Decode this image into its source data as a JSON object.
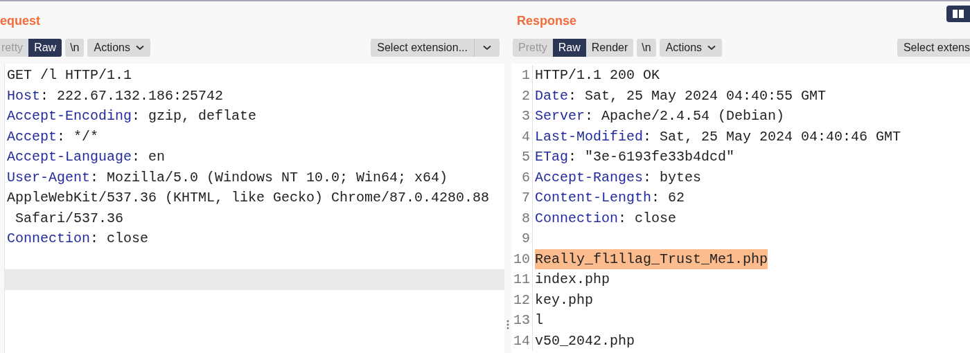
{
  "request": {
    "title": "equest",
    "view_tabs": [
      {
        "label": "retty",
        "selected": false
      },
      {
        "label": "Raw",
        "selected": true
      }
    ],
    "newline_button": "\\n",
    "actions_button": "Actions",
    "extension_select": "Select extension...",
    "lines": [
      {
        "value": "GET /l HTTP/1.1"
      },
      {
        "key": "Host",
        "value": ": 222.67.132.186:25742"
      },
      {
        "key": "Accept-Encoding",
        "value": ": gzip, deflate"
      },
      {
        "key": "Accept",
        "value": ": */*"
      },
      {
        "key": "Accept-Language",
        "value": ": en"
      },
      {
        "key": "User-Agent",
        "value": ": Mozilla/5.0 (Windows NT 10.0; Win64; x64)"
      },
      {
        "value": "AppleWebKit/537.36 (KHTML, like Gecko) Chrome/87.0.4280.88"
      },
      {
        "value": " Safari/537.36"
      },
      {
        "key": "Connection",
        "value": ": close"
      }
    ],
    "current_line": {
      "highlighted": true
    }
  },
  "response": {
    "title": "Response",
    "view_tabs": [
      {
        "label": "Pretty",
        "selected": false
      },
      {
        "label": "Raw",
        "selected": true
      },
      {
        "label": "Render",
        "selected": false
      }
    ],
    "newline_button": "\\n",
    "actions_button": "Actions",
    "extension_select": "Select extens",
    "lines": [
      {
        "number": "1",
        "value": "HTTP/1.1 200 OK",
        "highlighted": false
      },
      {
        "number": "2",
        "key": "Date",
        "value": ": Sat, 25 May 2024 04:40:55 GMT",
        "highlighted": false
      },
      {
        "number": "3",
        "key": "Server",
        "value": ": Apache/2.4.54 (Debian)",
        "highlighted": false
      },
      {
        "number": "4",
        "key": "Last-Modified",
        "value": ": Sat, 25 May 2024 04:40:46 GMT",
        "highlighted": false
      },
      {
        "number": "5",
        "key": "ETag",
        "value": ": \"3e-6193fe33b4dcd\"",
        "highlighted": false
      },
      {
        "number": "6",
        "key": "Accept-Ranges",
        "value": ": bytes",
        "highlighted": false
      },
      {
        "number": "7",
        "key": "Content-Length",
        "value": ": 62",
        "highlighted": false
      },
      {
        "number": "8",
        "key": "Connection",
        "value": ": close",
        "highlighted": false
      },
      {
        "number": "9",
        "highlighted": false
      },
      {
        "number": "10",
        "value": "Really_fl1llag_Trust_Me1.php",
        "highlighted": true
      },
      {
        "number": "11",
        "value": "index.php",
        "highlighted": false
      },
      {
        "number": "12",
        "value": "key.php",
        "highlighted": false
      },
      {
        "number": "13",
        "value": "l",
        "highlighted": false
      },
      {
        "number": "14",
        "value": "v50_2042.php",
        "highlighted": false
      }
    ]
  }
}
